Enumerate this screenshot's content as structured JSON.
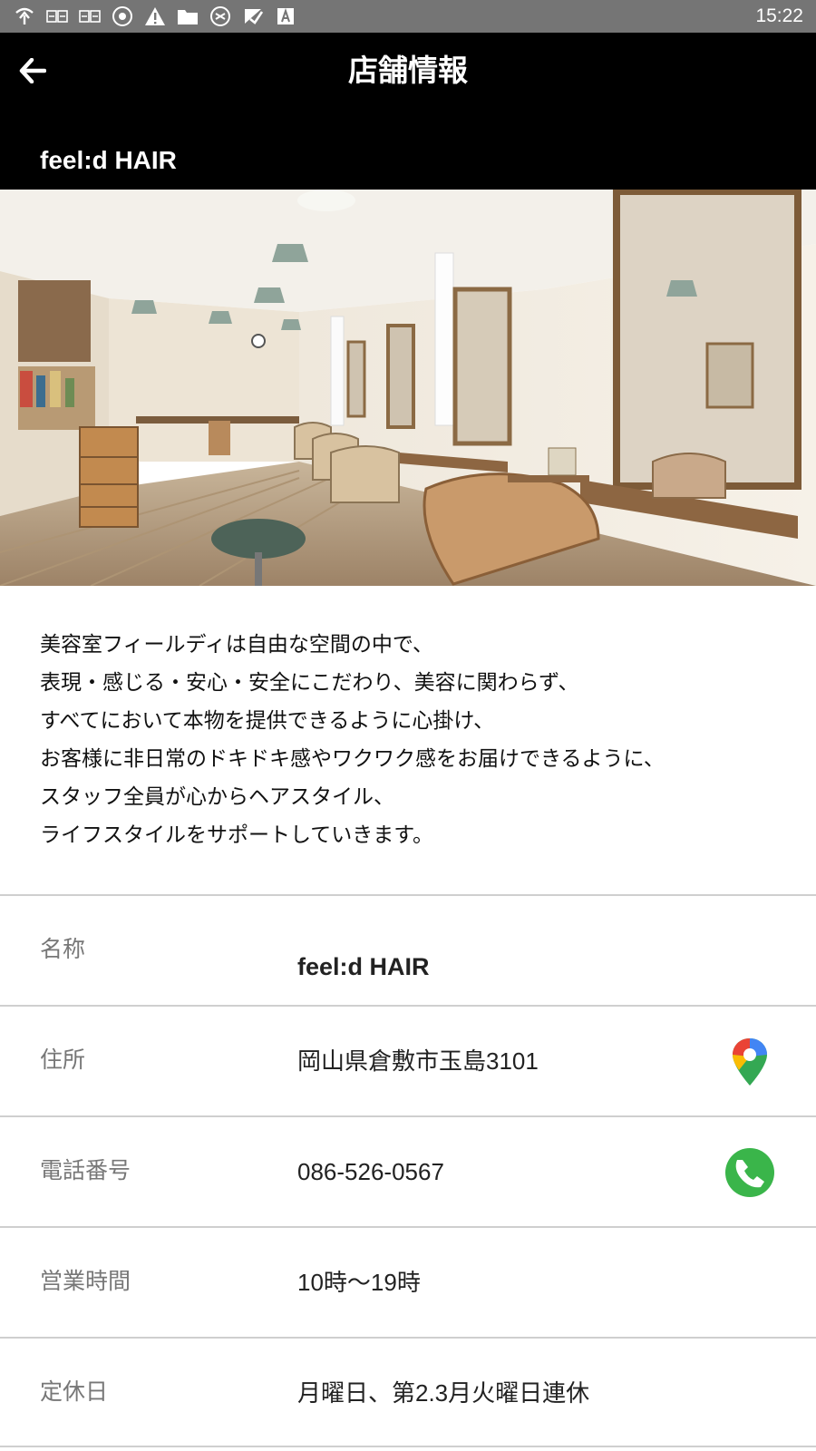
{
  "status_bar": {
    "time": "15:22",
    "icons": [
      "signal-icon",
      "sim-icon",
      "sim-icon",
      "settings-icon",
      "warning-icon",
      "folder-icon",
      "sync-icon",
      "check-icon",
      "font-icon"
    ]
  },
  "app_bar": {
    "title": "店舗情報",
    "back_icon": "back-arrow-icon",
    "shop_name": "feel:d HAIR"
  },
  "hero": {
    "image": "salon-interior-photo"
  },
  "description": {
    "lines": [
      "美容室フィールディは自由な空間の中で、",
      "表現・感じる・安心・安全にこだわり、美容に関わらず、",
      "すべてにおいて本物を提供できるように心掛け、",
      "お客様に非日常のドキドキ感やワクワク感をお届けできるように、",
      "スタッフ全員が心からヘアスタイル、",
      "ライフスタイルをサポートしていきます。"
    ]
  },
  "info": {
    "rows": [
      {
        "label": "名称",
        "value": "feel:d HAIR"
      },
      {
        "label": "住所",
        "value": "岡山県倉敷市玉島3101",
        "action_icon": "map-pin-icon"
      },
      {
        "label": "電話番号",
        "value": "086-526-0567",
        "action_icon": "phone-icon"
      },
      {
        "label": "営業時間",
        "value": "10時〜19時"
      },
      {
        "label": "定休日",
        "value": "月曜日、第2.3月火曜日連休"
      }
    ]
  },
  "colors": {
    "app_bar": "#000000",
    "status_bar": "#757575",
    "divider": "#cfcfcf",
    "label": "#777777",
    "phone_green": "#3ab54a"
  }
}
